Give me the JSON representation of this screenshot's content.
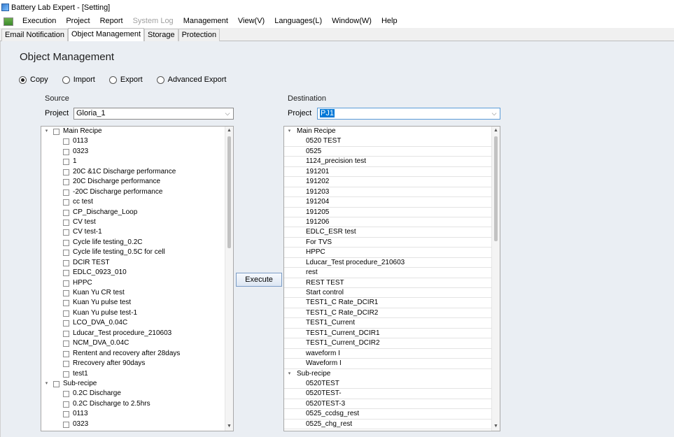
{
  "window": {
    "title": "Battery Lab Expert - [Setting]"
  },
  "menu": [
    "Execution",
    "Project",
    "Report",
    "System Log",
    "Management",
    "View(V)",
    "Languages(L)",
    "Window(W)",
    "Help"
  ],
  "menu_disabled": "System Log",
  "tabs": [
    "Email Notification",
    "Object Management",
    "Storage",
    "Protection"
  ],
  "active_tab": "Object Management",
  "heading": "Object Management",
  "modes": [
    {
      "label": "Copy",
      "selected": true
    },
    {
      "label": "Import",
      "selected": false
    },
    {
      "label": "Export",
      "selected": false
    },
    {
      "label": "Advanced Export",
      "selected": false
    }
  ],
  "source": {
    "label": "Source",
    "project_label": "Project",
    "project_value": "Gloria_1",
    "groups": [
      {
        "name": "Main Recipe",
        "items": [
          "0113",
          "0323",
          "1",
          "20C &1C Discharge performance",
          "20C Discharge performance",
          "-20C Discharge performance",
          "cc test",
          "CP_Discharge_Loop",
          "CV test",
          "CV test-1",
          "Cycle life testing_0.2C",
          "Cycle life testing_0.5C for cell",
          "DCIR TEST",
          "EDLC_0923_010",
          "HPPC",
          "Kuan Yu CR test",
          "Kuan Yu pulse test",
          "Kuan Yu pulse test-1",
          "LCO_DVA_0.04C",
          "Lducar_Test procedure_210603",
          "NCM_DVA_0.04C",
          "Rentent and recovery after 28days",
          "Rrecovery after 90days",
          "test1"
        ]
      },
      {
        "name": "Sub-recipe",
        "items": [
          "0.2C Discharge",
          "0.2C Discharge to 2.5hrs",
          "0113",
          "0323"
        ]
      }
    ]
  },
  "destination": {
    "label": "Destination",
    "project_label": "Project",
    "project_value": "PJ1",
    "groups": [
      {
        "name": "Main Recipe",
        "items": [
          "0520 TEST",
          "0525",
          "1124_precision test",
          "191201",
          "191202",
          "191203",
          "191204",
          "191205",
          "191206",
          "EDLC_ESR test",
          "For TVS",
          "HPPC",
          "Lducar_Test procedure_210603",
          "rest",
          "REST TEST",
          "Start control",
          "TEST1_C Rate_DCIR1",
          "TEST1_C Rate_DCIR2",
          "TEST1_Current",
          "TEST1_Current_DCIR1",
          "TEST1_Current_DCIR2",
          "waveform I",
          "Waveform I"
        ]
      },
      {
        "name": "Sub-recipe",
        "items": [
          "0520TEST",
          "0520TEST-",
          "0520TEST-3",
          "0525_ccdsg_rest",
          "0525_chg_rest"
        ]
      }
    ]
  },
  "execute_label": "Execute",
  "icons": {
    "expander_open": "▾",
    "chevron_down": "⌵",
    "scroll_up": "▲",
    "scroll_down": "▼"
  }
}
